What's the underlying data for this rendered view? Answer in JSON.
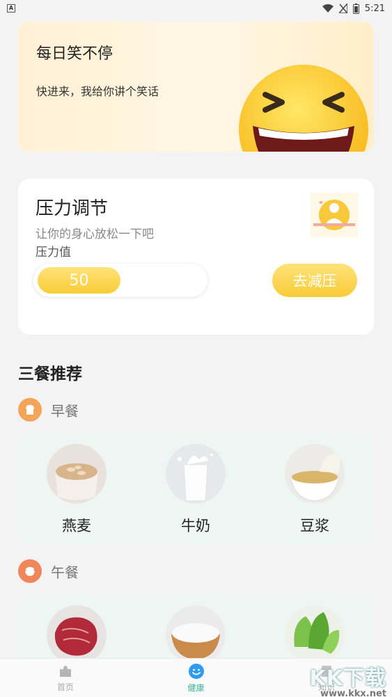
{
  "status": {
    "time": "5:21"
  },
  "joke": {
    "title": "每日笑不停",
    "subtitle": "快进来，我给你讲个笑话"
  },
  "stress": {
    "title": "压力调节",
    "subtitle": "让你的身心放松一下吧",
    "value_label": "压力值",
    "value": "50",
    "value_fraction": 0.5,
    "button": "去减压"
  },
  "meals": {
    "section_title": "三餐推荐",
    "breakfast": {
      "name": "早餐",
      "items": [
        "燕麦",
        "牛奶",
        "豆浆"
      ]
    },
    "lunch": {
      "name": "午餐",
      "items": [
        "",
        "",
        ""
      ]
    }
  },
  "tabs": [
    {
      "label": "首页",
      "icon": "puzzle-icon"
    },
    {
      "label": "健康",
      "icon": "smile-icon"
    },
    {
      "label": "知识",
      "icon": "book-icon"
    }
  ],
  "watermark": {
    "text": "KK下载",
    "url": "www.kkx.net"
  },
  "colors": {
    "accent": "#f9cd36",
    "active_tab": "#36b59a",
    "breakfast_icon": "#f5a55a",
    "lunch_icon": "#f0875a"
  }
}
